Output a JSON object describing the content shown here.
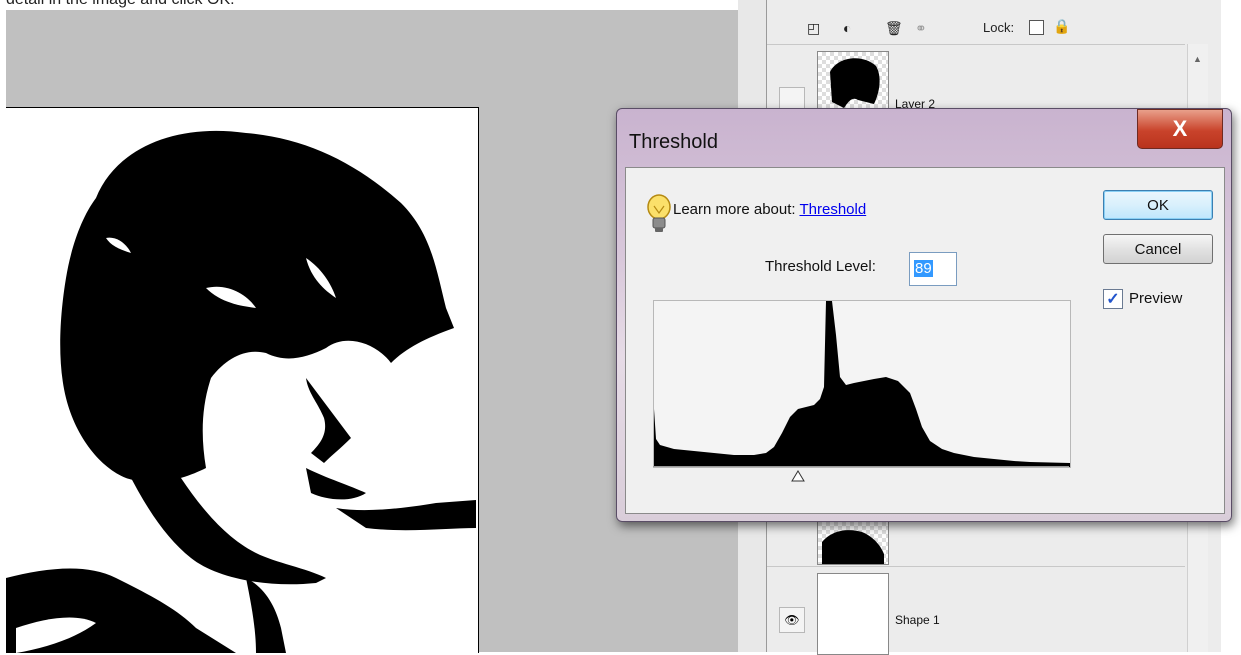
{
  "caption": "detail in the image and click OK.",
  "layers_panel": {
    "lock_label": "Lock:",
    "layers": [
      {
        "name": "Layer 2"
      },
      {
        "name": "Shape 1"
      }
    ]
  },
  "dialog": {
    "title": "Threshold",
    "close_label": "X",
    "learn_more_text": "Learn more about:",
    "learn_more_link": "Threshold",
    "threshold_level_label": "Threshold Level:",
    "threshold_level_value": "89",
    "ok_label": "OK",
    "cancel_label": "Cancel",
    "preview_label": "Preview",
    "preview_checked": true
  },
  "colors": {
    "link": "#0000ee",
    "close_button": "#c9432b",
    "selection": "#3399ff"
  }
}
